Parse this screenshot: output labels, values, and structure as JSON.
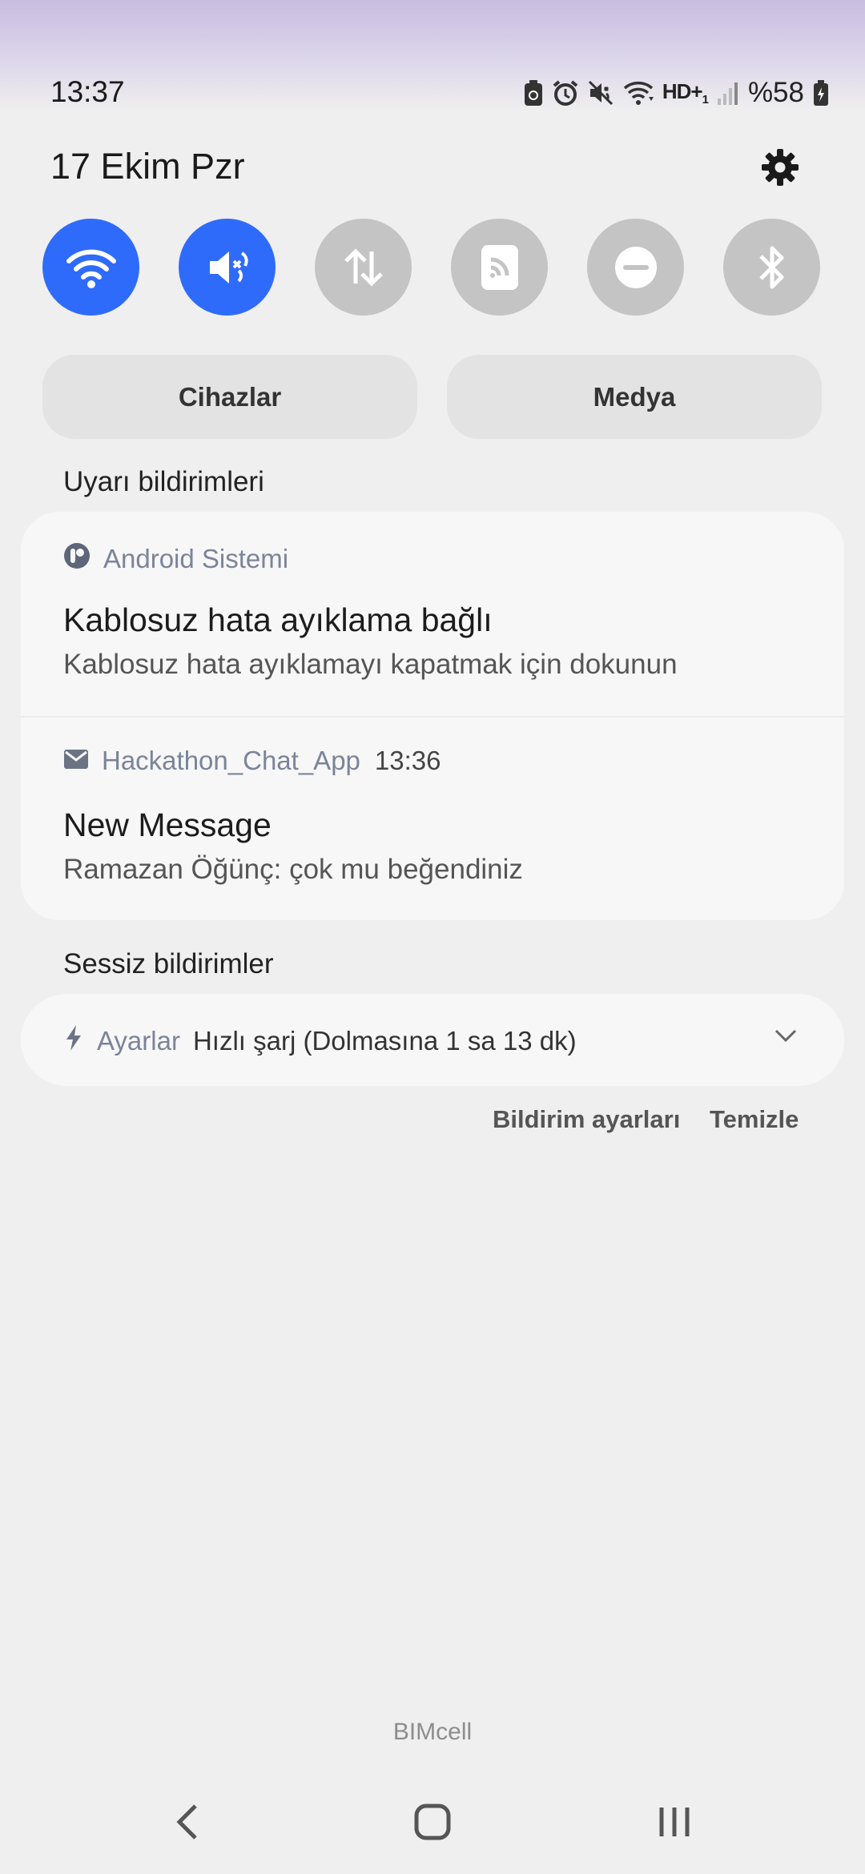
{
  "status_bar": {
    "time": "13:37",
    "network_label": "HD+",
    "network_sub": "1",
    "battery": "%58",
    "icons": [
      "battery-saver-icon",
      "alarm-icon",
      "mute-icon",
      "wifi-icon",
      "signal-icon",
      "battery-icon"
    ]
  },
  "header": {
    "date": "17 Ekim Pzr"
  },
  "quick_toggles": [
    {
      "name": "wifi",
      "state": "on"
    },
    {
      "name": "sound-mute",
      "state": "on"
    },
    {
      "name": "mobile-data",
      "state": "off"
    },
    {
      "name": "nfc",
      "state": "off"
    },
    {
      "name": "do-not-disturb",
      "state": "off"
    },
    {
      "name": "bluetooth",
      "state": "off"
    }
  ],
  "chips": {
    "devices": "Cihazlar",
    "media": "Medya"
  },
  "alerts": {
    "section_title": "Uyarı bildirimleri",
    "items": [
      {
        "app": "Android Sistemi",
        "time": "",
        "title": "Kablosuz hata ayıklama bağlı",
        "text": "Kablosuz hata ayıklamayı kapatmak için dokunun"
      },
      {
        "app": "Hackathon_Chat_App",
        "time": "13:36",
        "title": "New Message",
        "text": "Ramazan Öğünç: çok mu beğendiniz"
      }
    ]
  },
  "silent": {
    "section_title": "Sessiz bildirimler",
    "app": "Ayarlar",
    "text": "Hızlı şarj (Dolmasına 1 sa 13 dk)"
  },
  "footer": {
    "settings": "Bildirim ayarları",
    "clear": "Temizle"
  },
  "carrier": "BIMcell",
  "colors": {
    "accent": "#2f6bfb",
    "toggle_off": "#c4c4c4",
    "card": "#f7f7f7"
  }
}
